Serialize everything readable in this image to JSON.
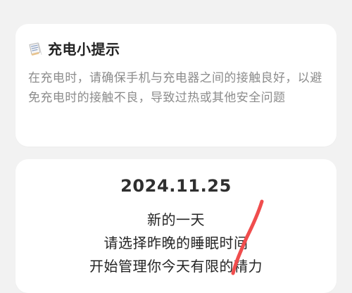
{
  "tip_card": {
    "icon": "note-icon",
    "title": "充电小提示",
    "body": "在充电时，请确保手机与充电器之间的接触良好，以避免充电时的接触不良，导致过热或其他安全问题"
  },
  "sleep_card": {
    "date": "2024.11.25",
    "line1": "新的一天",
    "line2": "请选择昨晚的睡眠时间",
    "line3": "开始管理你今天有限的精力"
  },
  "colors": {
    "background": "#f2f2f2",
    "card": "#ffffff",
    "title": "#222222",
    "body_text": "#8c8c8c",
    "accent_red": "#f04d4d"
  }
}
